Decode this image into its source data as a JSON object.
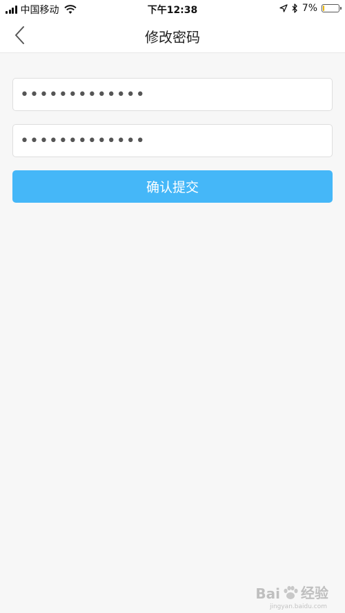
{
  "status_bar": {
    "carrier": "中国移动",
    "time": "下午12:38",
    "battery_text": "7%",
    "battery_level": 0.07,
    "icons": [
      "signal-icon",
      "wifi-icon",
      "location-arrow-icon",
      "bluetooth-icon",
      "battery-icon"
    ]
  },
  "nav": {
    "title": "修改密码",
    "back_icon": "chevron-left-icon"
  },
  "form": {
    "old_password_value": "•••••••••••••",
    "new_password_value": "•••••••••••••",
    "submit_label": "确认提交",
    "submit_color": "#45b7f8"
  },
  "watermark": {
    "brand": "Bai",
    "brand_suffix": "经验",
    "url": "jingyan.baidu.com"
  }
}
